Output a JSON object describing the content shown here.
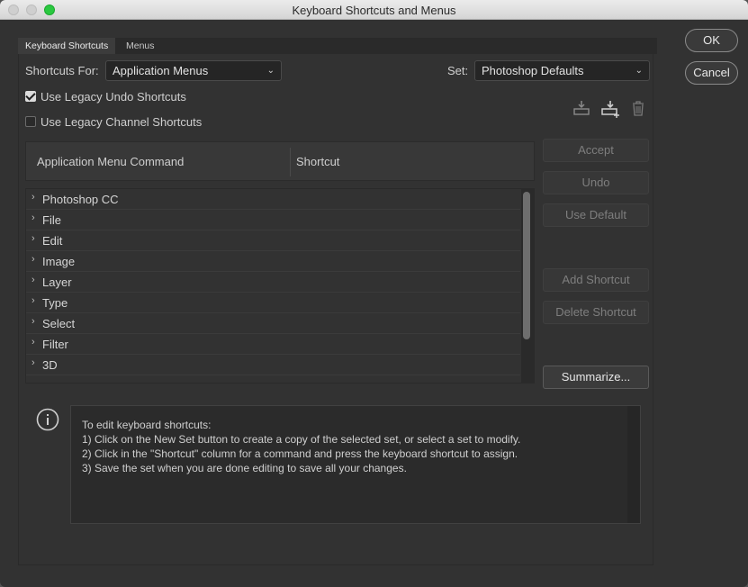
{
  "window": {
    "title": "Keyboard Shortcuts and Menus"
  },
  "tabs": [
    {
      "label": "Keyboard Shortcuts",
      "active": true
    },
    {
      "label": "Menus",
      "active": false
    }
  ],
  "controls": {
    "shortcuts_for_label": "Shortcuts For:",
    "shortcuts_for_value": "Application Menus",
    "set_label": "Set:",
    "set_value": "Photoshop Defaults",
    "legacy_undo": {
      "label": "Use Legacy Undo Shortcuts",
      "checked": true
    },
    "legacy_channel": {
      "label": "Use Legacy Channel Shortcuts",
      "checked": false
    }
  },
  "icons": {
    "save_set": "save-set-icon",
    "new_set": "new-set-icon",
    "delete_set": "trash-icon",
    "info": "info-icon"
  },
  "table": {
    "col_command": "Application Menu Command",
    "col_shortcut": "Shortcut",
    "rows": [
      {
        "label": "Photoshop CC"
      },
      {
        "label": "File"
      },
      {
        "label": "Edit"
      },
      {
        "label": "Image"
      },
      {
        "label": "Layer"
      },
      {
        "label": "Type"
      },
      {
        "label": "Select"
      },
      {
        "label": "Filter"
      },
      {
        "label": "3D"
      }
    ]
  },
  "side_buttons": {
    "accept": "Accept",
    "undo": "Undo",
    "use_default": "Use Default",
    "add_shortcut": "Add Shortcut",
    "delete_shortcut": "Delete Shortcut",
    "summarize": "Summarize..."
  },
  "dialog_buttons": {
    "ok": "OK",
    "cancel": "Cancel"
  },
  "info": {
    "lines": [
      "To edit keyboard shortcuts:",
      "1) Click on the New Set button to create a copy of the selected set, or select a set to modify.",
      "2) Click in the \"Shortcut\" column for a command and press the keyboard shortcut to assign.",
      "3) Save the set when you are done editing to save all your changes."
    ]
  },
  "colors": {
    "background": "#323232",
    "titlebar": "#e0e0e0",
    "zoom_button": "#2ac840"
  }
}
